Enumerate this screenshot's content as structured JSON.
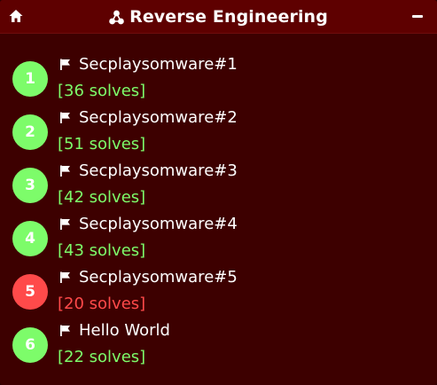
{
  "header": {
    "title": "Reverse Engineering",
    "home_icon": "home-icon",
    "category_icon": "triangle-nodes-icon",
    "minimize_icon": "minimize-icon"
  },
  "colors": {
    "background": "#3d0000",
    "header": "#5e0000",
    "normal": "#7dfc6a",
    "low": "#ff4a4a"
  },
  "challenges": [
    {
      "rank": "1",
      "name": "Secplaysomware#1",
      "solves": "[36 solves]",
      "status": "ok"
    },
    {
      "rank": "2",
      "name": "Secplaysomware#2",
      "solves": "[51 solves]",
      "status": "ok"
    },
    {
      "rank": "3",
      "name": "Secplaysomware#3",
      "solves": "[42 solves]",
      "status": "ok"
    },
    {
      "rank": "4",
      "name": "Secplaysomware#4",
      "solves": "[43 solves]",
      "status": "ok"
    },
    {
      "rank": "5",
      "name": "Secplaysomware#5",
      "solves": "[20 solves]",
      "status": "hot"
    },
    {
      "rank": "6",
      "name": "Hello World",
      "solves": "[22 solves]",
      "status": "ok"
    }
  ]
}
